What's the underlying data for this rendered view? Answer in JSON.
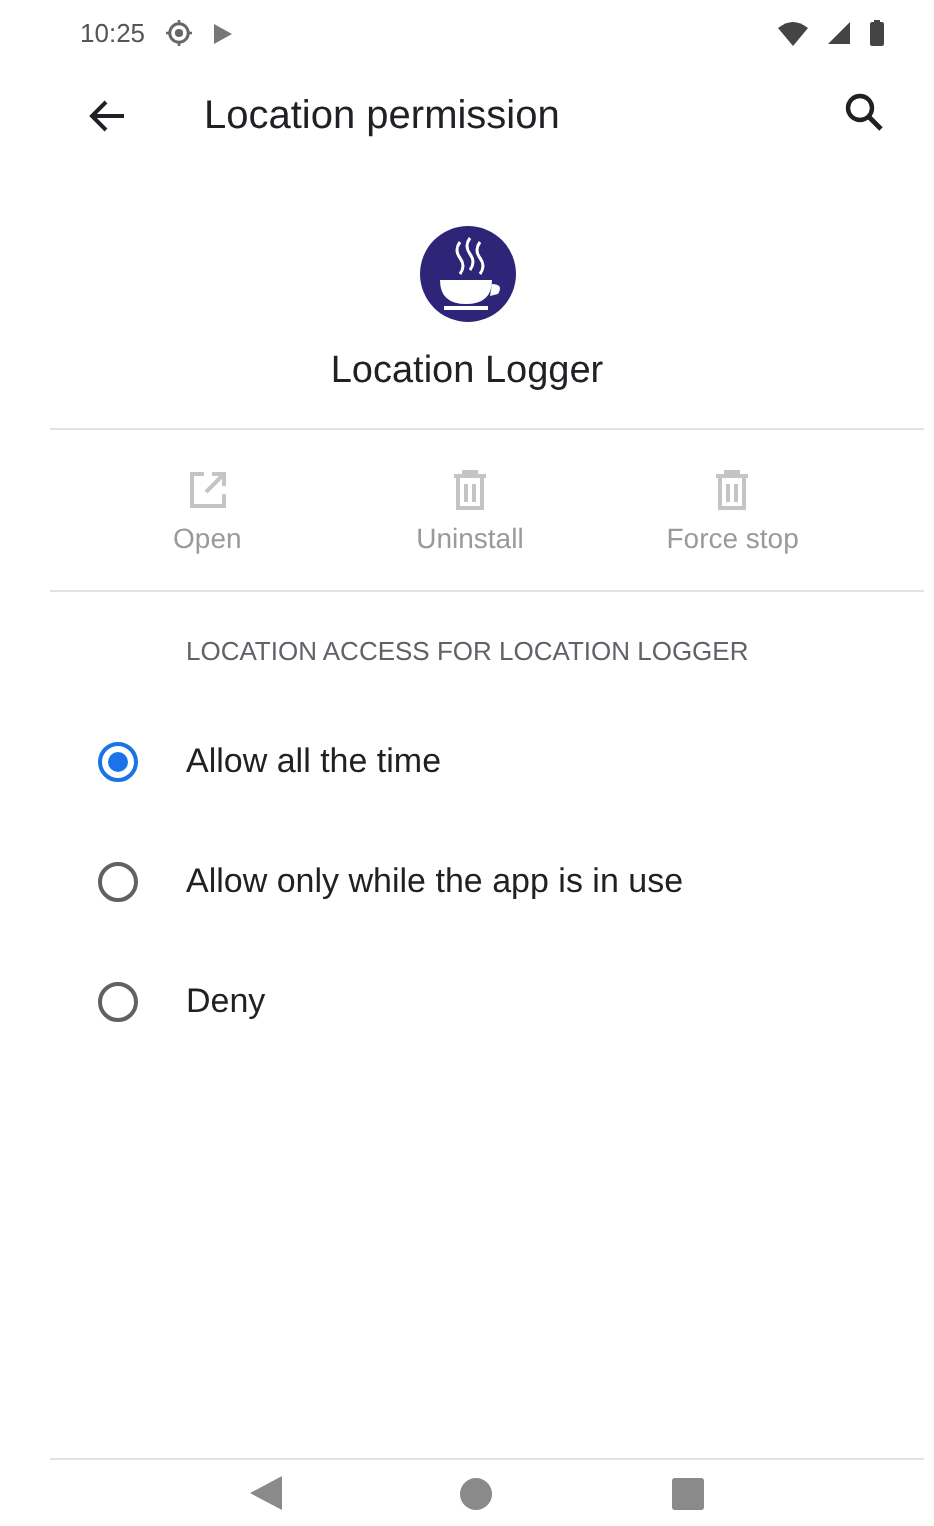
{
  "status_bar": {
    "time": "10:25"
  },
  "toolbar": {
    "title": "Location permission"
  },
  "app": {
    "name": "Location Logger"
  },
  "actions": [
    {
      "label": "Open",
      "kind": "open",
      "disabled": true
    },
    {
      "label": "Uninstall",
      "kind": "trash",
      "disabled": true
    },
    {
      "label": "Force stop",
      "kind": "trash",
      "disabled": true
    }
  ],
  "section": {
    "header": "LOCATION ACCESS FOR LOCATION LOGGER"
  },
  "options": [
    {
      "label": "Allow all the time",
      "selected": true
    },
    {
      "label": "Allow only while the app is in use",
      "selected": false
    },
    {
      "label": "Deny",
      "selected": false
    }
  ]
}
